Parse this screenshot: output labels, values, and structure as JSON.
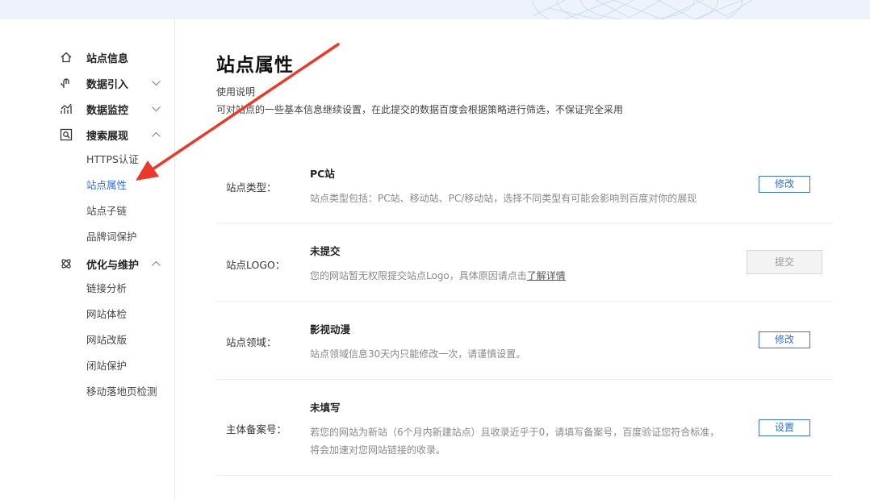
{
  "sidebar": {
    "groups": [
      {
        "label": "站点信息",
        "icon": "home-icon",
        "chevron": ""
      },
      {
        "label": "数据引入",
        "icon": "data-import-icon",
        "chevron": "chevron-down-icon"
      },
      {
        "label": "数据监控",
        "icon": "monitor-chart-icon",
        "chevron": "chevron-down-icon"
      },
      {
        "label": "搜索展现",
        "icon": "search-display-icon",
        "chevron": "chevron-up-icon"
      },
      {
        "label": "优化与维护",
        "icon": "optimize-icon",
        "chevron": "chevron-up-icon"
      }
    ],
    "search_items": [
      "HTTPS认证",
      "站点属性",
      "站点子链",
      "品牌词保护"
    ],
    "optimize_items": [
      "链接分析",
      "网站体检",
      "网站改版",
      "闭站保护",
      "移动落地页检测"
    ],
    "active_item": "站点属性"
  },
  "main": {
    "title": "站点属性",
    "desc_title": "使用说明",
    "desc_text": "可对站点的一些基本信息继续设置，在此提交的数据百度会根据策略进行筛选，不保证完全采用",
    "rows": [
      {
        "label": "站点类型：",
        "value": "PC站",
        "hint": "站点类型包括：PC站、移动站、PC/移动站，选择不同类型有可能会影响到百度对你的展现",
        "button": "修改"
      },
      {
        "label": "站点LOGO：",
        "value": "未提交",
        "hint_prefix": "您的网站暂无权限提交站点Logo，具体原因请点击",
        "hint_link": "了解详情",
        "button": "提交"
      },
      {
        "label": "站点领域：",
        "value": "影视动漫",
        "hint": "站点领域信息30天内只能修改一次，请谨慎设置。",
        "button": "修改"
      },
      {
        "label": "主体备案号：",
        "value": "未填写",
        "hint": "若您的网站为新站（6个月内新建站点）且收录近乎于0，请填写备案号，百度验证您符合标准，",
        "hint2": "将会加速对您网站链接的收录。",
        "button": "设置"
      }
    ]
  },
  "colors": {
    "accent": "#2f6fd8",
    "arrow": "#e8392b",
    "band": "#edf2fb"
  }
}
